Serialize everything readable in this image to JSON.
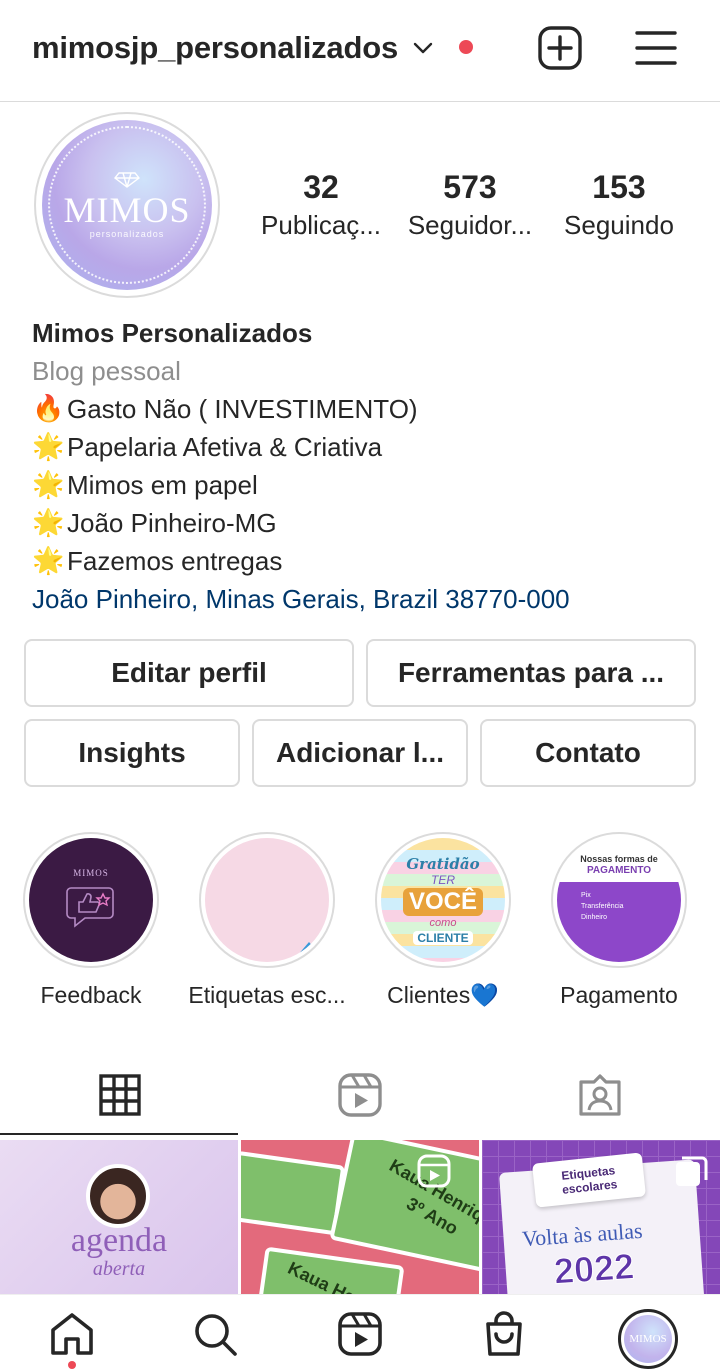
{
  "header": {
    "username": "mimosjp_personalizados",
    "notification_color": "#ed4956",
    "icons": [
      "chevron-down-icon",
      "new-post-icon",
      "menu-icon"
    ]
  },
  "profile": {
    "avatar_brand": "MIMOS",
    "avatar_sub": "personalizados",
    "stats": [
      {
        "value": "32",
        "label": "Publicaç..."
      },
      {
        "value": "573",
        "label": "Seguidor..."
      },
      {
        "value": "153",
        "label": "Seguindo"
      }
    ]
  },
  "bio": {
    "name": "Mimos Personalizados",
    "category": "Blog pessoal",
    "lines": [
      {
        "emoji": "🔥",
        "text": "Gasto Não ( INVESTIMENTO)"
      },
      {
        "emoji": "🌟",
        "text": "Papelaria Afetiva & Criativa"
      },
      {
        "emoji": "🌟",
        "text": "Mimos em papel"
      },
      {
        "emoji": "🌟",
        "text": "João Pinheiro-MG"
      },
      {
        "emoji": "🌟",
        "text": "Fazemos entregas"
      }
    ],
    "location": "João Pinheiro, Minas Gerais, Brazil 38770-000"
  },
  "actions": {
    "edit_profile": "Editar perfil",
    "tools": "Ferramentas para ...",
    "insights": "Insights",
    "add": "Adicionar l...",
    "contact": "Contato"
  },
  "highlights": [
    {
      "label": "Feedback",
      "mini": "MIMOS"
    },
    {
      "label": "Etiquetas esc..."
    },
    {
      "label": "Clientes💙",
      "cover": [
        "Gratidão",
        "TER",
        "VOCÊ",
        "como",
        "CLIENTE"
      ]
    },
    {
      "label": "Pagamento",
      "cover_title": "Nossas formas de",
      "cover_sub": "PAGAMENTO",
      "options": [
        "Pix",
        "Transferência",
        "Dinheiro"
      ]
    }
  ],
  "tabs": [
    "grid-icon",
    "reels-icon",
    "tagged-icon"
  ],
  "posts": [
    {
      "title": "agenda",
      "subtitle": "aberta"
    },
    {
      "card_text_1": "Kaua Henriq",
      "card_text_2": "3º Ano",
      "card_text_3": "Kaua He"
    },
    {
      "tag": "Etiquetas escolares",
      "headline": "Volta às aulas",
      "year": "2022"
    }
  ],
  "bottom_nav": [
    "home-icon",
    "search-icon",
    "reels-icon",
    "shop-icon",
    "profile-avatar"
  ],
  "colors": {
    "text": "#262626",
    "muted": "#8e8e8e",
    "link": "#00376b",
    "border": "#dbdbdb",
    "accent": "#ed4956"
  }
}
